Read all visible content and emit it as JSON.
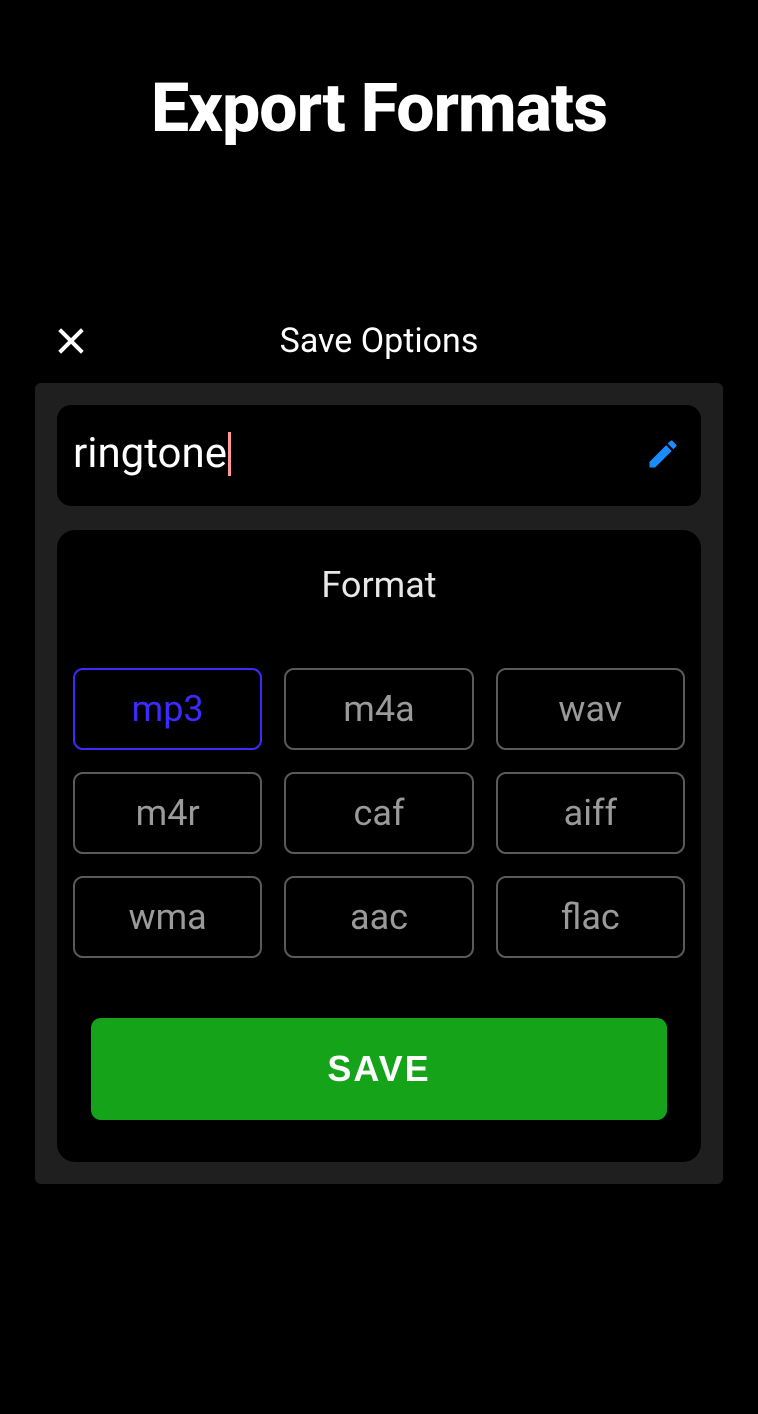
{
  "page": {
    "heading": "Export Formats"
  },
  "modal": {
    "title": "Save Options",
    "filename": "ringtone",
    "format_label": "Format",
    "save_button": "SAVE",
    "formats": [
      {
        "label": "mp3",
        "selected": true
      },
      {
        "label": "m4a",
        "selected": false
      },
      {
        "label": "wav",
        "selected": false
      },
      {
        "label": "m4r",
        "selected": false
      },
      {
        "label": "caf",
        "selected": false
      },
      {
        "label": "aiff",
        "selected": false
      },
      {
        "label": "wma",
        "selected": false
      },
      {
        "label": "aac",
        "selected": false
      },
      {
        "label": "flac",
        "selected": false
      }
    ]
  }
}
